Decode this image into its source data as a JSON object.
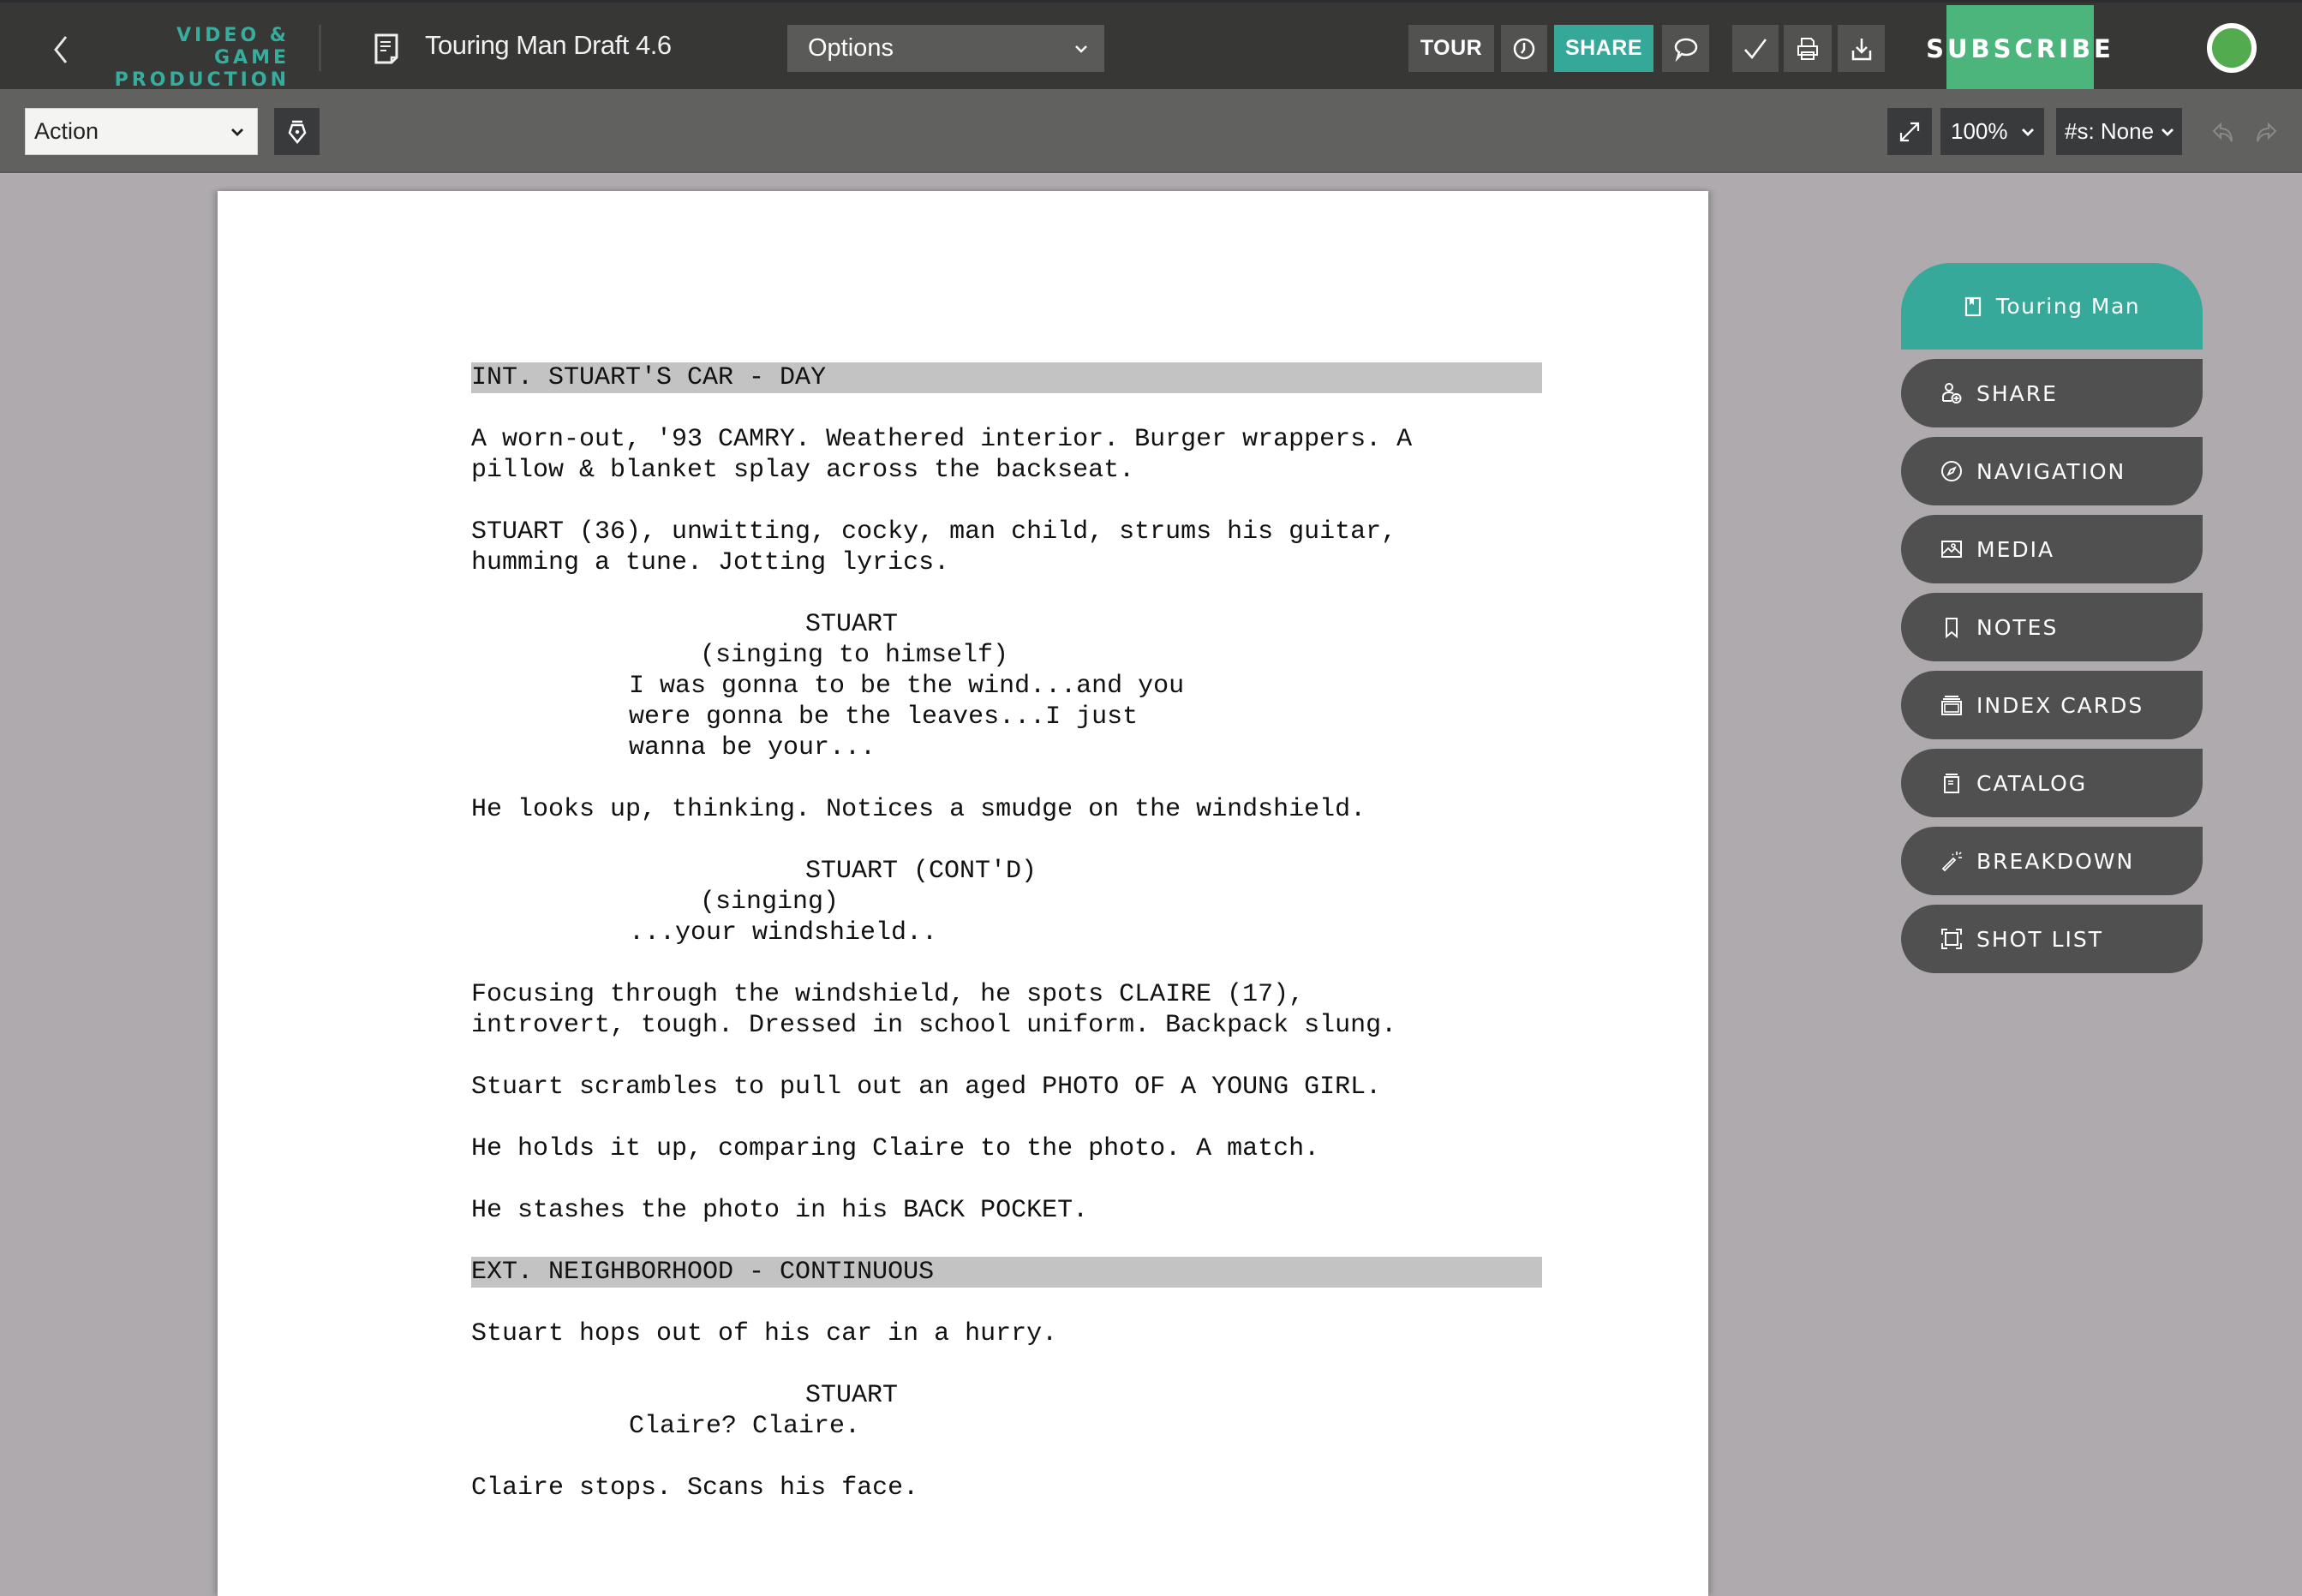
{
  "topbar": {
    "brand_line1": "VIDEO & GAME",
    "brand_line2": "PRODUCTION",
    "doc_title": "Touring Man Draft 4.6",
    "options_label": "Options",
    "tour_label": "TOUR",
    "share_label": "SHARE",
    "subscribe_label": "SUBSCRIBE",
    "icons": [
      "back-chevron-icon",
      "document-icon",
      "chevron-down-icon",
      "clock-icon",
      "speech-bubble-icon",
      "checkmark-icon",
      "printer-icon",
      "download-icon"
    ],
    "status_color": "#53ab50"
  },
  "toolbar2": {
    "element_type": "Action",
    "zoom_level": "100%",
    "scene_numbering": "#s: None",
    "icons": [
      "pen-nib-icon",
      "expand-icon",
      "undo-icon",
      "redo-icon"
    ]
  },
  "script": {
    "scene1_heading": "INT. STUART'S CAR - DAY",
    "action1": "A worn-out, '93 CAMRY. Weathered interior. Burger wrappers. A\npillow & blanket splay across the backseat.",
    "action2": "STUART (36), unwitting, cocky, man child, strums his guitar,\nhumming a tune. Jotting lyrics.",
    "dialog1_character": "STUART",
    "dialog1_paren": "(singing to himself)",
    "dialog1_text": "I was gonna to be the wind...and you\nwere gonna be the leaves...I just\nwanna be your...",
    "action3": "He looks up, thinking. Notices a smudge on the windshield.",
    "dialog2_character": "STUART (CONT'D)",
    "dialog2_paren": "(singing)",
    "dialog2_text": "...your windshield..",
    "action4": "Focusing through the windshield, he spots CLAIRE (17),\nintrovert, tough. Dressed in school uniform. Backpack slung.",
    "action5": "Stuart scrambles to pull out an aged PHOTO OF A YOUNG GIRL.",
    "action6": "He holds it up, comparing Claire to the photo. A match.",
    "action7": "He stashes the photo in his BACK POCKET.",
    "scene2_heading": "EXT. NEIGHBORHOOD - CONTINUOUS",
    "action8": "Stuart hops out of his car in a hurry.",
    "dialog3_character": "STUART",
    "dialog3_text": "Claire? Claire.",
    "action9": "Claire stops. Scans his face."
  },
  "panel": {
    "title": "Touring Man",
    "items": [
      {
        "label": "SHARE",
        "icon": "user-add-icon"
      },
      {
        "label": "NAVIGATION",
        "icon": "compass-icon"
      },
      {
        "label": "MEDIA",
        "icon": "image-icon"
      },
      {
        "label": "NOTES",
        "icon": "bookmark-icon"
      },
      {
        "label": "INDEX CARDS",
        "icon": "cards-icon"
      },
      {
        "label": "CATALOG",
        "icon": "catalog-icon"
      },
      {
        "label": "BREAKDOWN",
        "icon": "magic-wand-icon"
      },
      {
        "label": "SHOT LIST",
        "icon": "frame-icon"
      }
    ],
    "accent_color": "#36a99a"
  }
}
